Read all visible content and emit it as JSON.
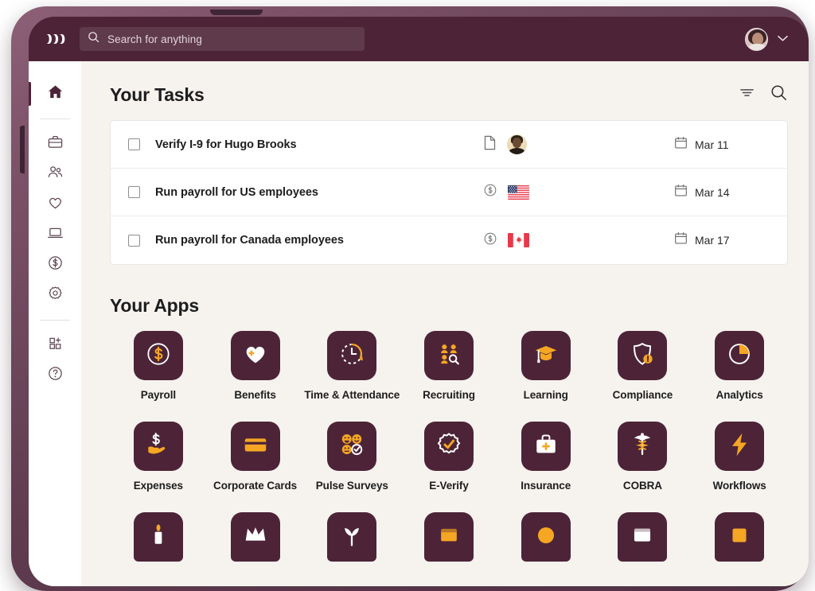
{
  "device": {
    "name": "tablet-frame"
  },
  "topbar": {
    "logo_name": "rippling-logo",
    "search": {
      "placeholder": "Search for anything",
      "value": "",
      "icon": "search-icon"
    },
    "avatar_name": "user-avatar",
    "chevron": "chevron-down-icon"
  },
  "sidebar": {
    "items": [
      {
        "name": "home",
        "icon": "home-icon",
        "active": true
      },
      {
        "name": "briefcase",
        "icon": "briefcase-icon",
        "active": false
      },
      {
        "name": "people",
        "icon": "people-icon",
        "active": false
      },
      {
        "name": "benefits",
        "icon": "heart-icon",
        "active": false
      },
      {
        "name": "devices",
        "icon": "laptop-icon",
        "active": false
      },
      {
        "name": "finance",
        "icon": "dollar-circle-icon",
        "active": false
      },
      {
        "name": "settings",
        "icon": "gear-icon",
        "active": false
      },
      {
        "name": "add-apps",
        "icon": "add-apps-grid-icon",
        "active": false
      },
      {
        "name": "help",
        "icon": "question-circle-icon",
        "active": false
      }
    ]
  },
  "tasks": {
    "title": "Your Tasks",
    "actions": [
      {
        "name": "filter",
        "icon": "filter-icon"
      },
      {
        "name": "search",
        "icon": "search-icon"
      }
    ],
    "rows": [
      {
        "label": "Verify I-9 for Hugo Brooks",
        "type_icon": "document-icon",
        "badge": "avatar",
        "badge_name": "hugo-brooks-avatar",
        "due_icon": "calendar-icon",
        "due": "Mar 11",
        "checked": false
      },
      {
        "label": "Run payroll for US employees",
        "type_icon": "dollar-circle-icon",
        "badge": "flag-us",
        "badge_name": "us-flag-icon",
        "due_icon": "calendar-icon",
        "due": "Mar 14",
        "checked": false
      },
      {
        "label": "Run payroll for Canada employees",
        "type_icon": "dollar-circle-icon",
        "badge": "flag-ca",
        "badge_name": "canada-flag-icon",
        "due_icon": "calendar-icon",
        "due": "Mar 17",
        "checked": false
      }
    ]
  },
  "apps": {
    "title": "Your Apps",
    "items": [
      {
        "label": "Payroll",
        "icon": "dollar-circle-icon"
      },
      {
        "label": "Benefits",
        "icon": "heart-plus-icon"
      },
      {
        "label": "Time & Attendance",
        "icon": "clock-icon"
      },
      {
        "label": "Recruiting",
        "icon": "people-search-icon"
      },
      {
        "label": "Learning",
        "icon": "graduation-cap-icon"
      },
      {
        "label": "Compliance",
        "icon": "shield-alert-icon"
      },
      {
        "label": "Analytics",
        "icon": "pie-chart-icon"
      },
      {
        "label": "Expenses",
        "icon": "hand-dollar-icon"
      },
      {
        "label": "Corporate Cards",
        "icon": "credit-card-icon"
      },
      {
        "label": "Pulse Surveys",
        "icon": "emoji-survey-icon"
      },
      {
        "label": "E-Verify",
        "icon": "badge-check-icon"
      },
      {
        "label": "Insurance",
        "icon": "medical-kit-icon"
      },
      {
        "label": "COBRA",
        "icon": "caduceus-icon"
      },
      {
        "label": "Workflows",
        "icon": "lightning-bolt-icon"
      }
    ],
    "partial_row": [
      {
        "label": "",
        "icon": "candle-icon"
      },
      {
        "label": "",
        "icon": "crown-icon"
      },
      {
        "label": "",
        "icon": "plant-icon"
      },
      {
        "label": "",
        "icon": "box-icon"
      },
      {
        "label": "",
        "icon": "circle-icon"
      },
      {
        "label": "",
        "icon": "window-icon"
      },
      {
        "label": "",
        "icon": "square-icon"
      }
    ]
  },
  "colors": {
    "brand_plum": "#4d2437",
    "accent_gold": "#f5a623",
    "canvas": "#f6f3ee",
    "card": "#ffffff",
    "text": "#1d1d1d"
  }
}
